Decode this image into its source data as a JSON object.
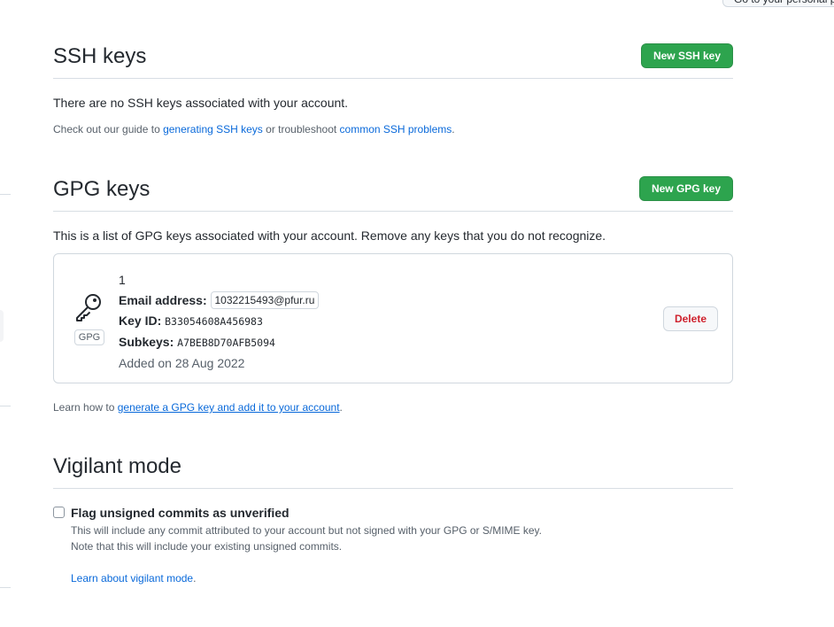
{
  "top_button": {
    "label": "Go to your personal profile"
  },
  "ssh": {
    "title": "SSH keys",
    "new_button": "New SSH key",
    "empty_text": "There are no SSH keys associated with your account.",
    "guide_prefix": "Check out our guide to ",
    "guide_link": "generating SSH keys",
    "guide_middle": " or troubleshoot ",
    "problems_link": "common SSH problems",
    "guide_suffix": "."
  },
  "gpg": {
    "title": "GPG keys",
    "new_button": "New GPG key",
    "intro": "This is a list of GPG keys associated with your account. Remove any keys that you do not recognize.",
    "keys": [
      {
        "name": "1",
        "badge": "GPG",
        "icon": "key-icon",
        "email_label": "Email address:",
        "email": "1032215493@pfur.ru",
        "key_id_label": "Key ID:",
        "key_id": "B33054608A456983",
        "subkeys_label": "Subkeys:",
        "subkeys": "A7BEB8D70AFB5094",
        "added": "Added on 28 Aug 2022",
        "delete_button": "Delete"
      }
    ],
    "learn_prefix": "Learn how to ",
    "learn_link": "generate a GPG key and add it to your account",
    "learn_suffix": "."
  },
  "vigilant": {
    "title": "Vigilant mode",
    "checkbox_label": "Flag unsigned commits as unverified",
    "checked": false,
    "note1": "This will include any commit attributed to your account but not signed with your GPG or S/MIME key.",
    "note2": "Note that this will include your existing unsigned commits.",
    "learn_link": "Learn about vigilant mode",
    "learn_suffix": "."
  },
  "colors": {
    "primary_button": "#2da44e",
    "link": "#0969da",
    "danger": "#cf222e",
    "border": "#d0d7de"
  }
}
